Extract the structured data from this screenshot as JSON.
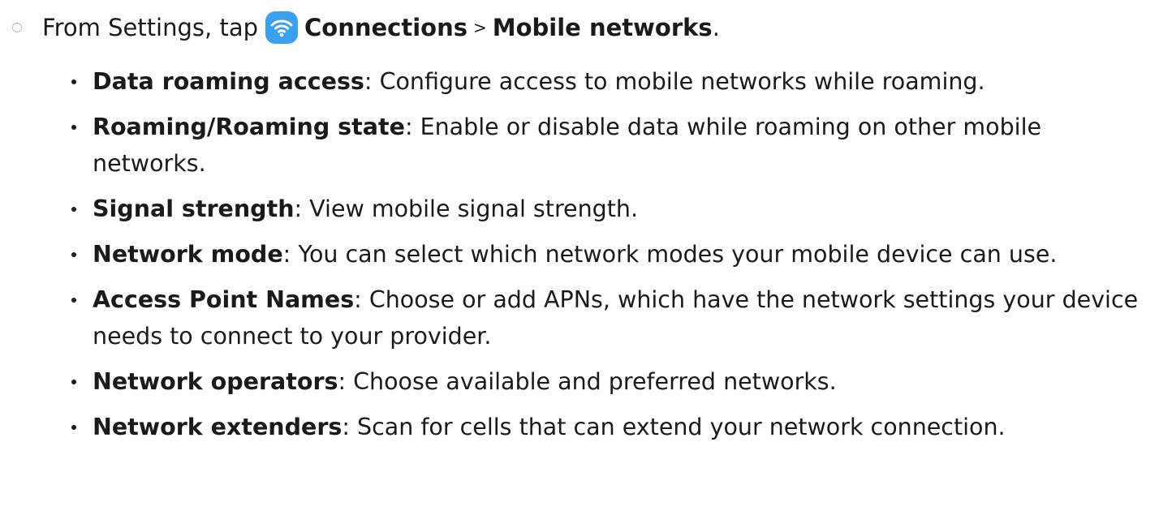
{
  "step": {
    "prefix": "From Settings, tap",
    "icon": "wifi-icon",
    "icon_color": "#3aa0f0",
    "path_first": "Connections",
    "separator": ">",
    "path_second": "Mobile networks",
    "suffix": "."
  },
  "items": [
    {
      "term": "Data roaming access",
      "desc": "Configure access to mobile networks while roaming."
    },
    {
      "term": "Roaming/Roaming state",
      "desc": "Enable or disable data while roaming on other mobile networks."
    },
    {
      "term": "Signal strength",
      "desc": "View mobile signal strength."
    },
    {
      "term": "Network mode",
      "desc": "You can select which network modes your mobile device can use."
    },
    {
      "term": "Access Point Names",
      "desc": "Choose or add APNs, which have the network settings your device needs to connect to your provider."
    },
    {
      "term": "Network operators",
      "desc": "Choose available and preferred networks."
    },
    {
      "term": "Network extenders",
      "desc": "Scan for cells that can extend your network connection."
    }
  ]
}
